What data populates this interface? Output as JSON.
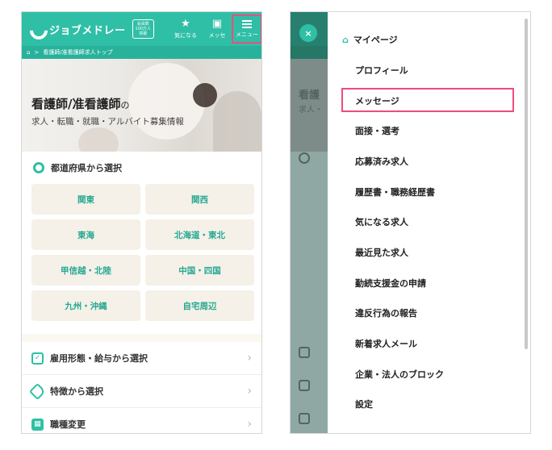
{
  "left": {
    "header": {
      "logo": "ジョブメドレー",
      "badge_lines": [
        "会員数",
        "100万人",
        "突破"
      ],
      "favorites_label": "気になる",
      "messages_label": "メッセ",
      "menu_label": "メニュー"
    },
    "breadcrumb": {
      "home": "⌂",
      "separator": ">",
      "current": "看護師/准看護師求人トップ"
    },
    "hero": {
      "title_main": "看護師/准看護師",
      "title_suffix": "の",
      "subtitle": "求人・転職・就職・アルバイト募集情報"
    },
    "prefecture_section": {
      "heading": "都道府県から選択",
      "regions": [
        "関東",
        "関西",
        "東海",
        "北海道・東北",
        "甲信越・北陸",
        "中国・四国",
        "九州・沖縄",
        "自宅周辺"
      ]
    },
    "filters": [
      {
        "label": "雇用形態・給与から選択",
        "icon": "check-box-icon"
      },
      {
        "label": "特徴から選択",
        "icon": "tag-icon"
      },
      {
        "label": "職種変更",
        "icon": "grid-icon"
      }
    ],
    "chevron": "›"
  },
  "right": {
    "close": "×",
    "dim_header_text": "看護",
    "dim_sub_text": "求人・",
    "menu_items": [
      "マイページ",
      "プロフィール",
      "メッセージ",
      "面接・選考",
      "応募済み求人",
      "履歴書・職務経歴書",
      "気になる求人",
      "最近見た求人",
      "勤続支援金の申請",
      "違反行為の報告",
      "新着求人メール",
      "企業・法人のブロック",
      "設定"
    ]
  },
  "colors": {
    "brand": "#2fbfa6",
    "highlight": "#ec4d7b",
    "region_bg": "#f5f1e8"
  }
}
